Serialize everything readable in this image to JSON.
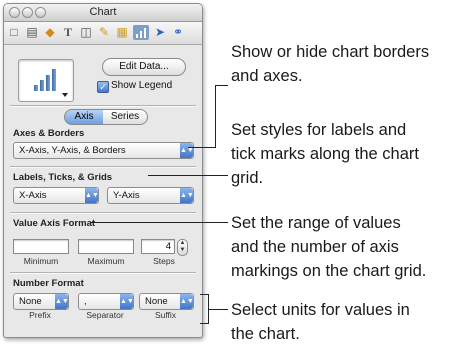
{
  "window": {
    "title": "Chart"
  },
  "toolbar": {
    "icons": [
      "document-icon",
      "layout-icon",
      "graphic-icon",
      "text-icon",
      "metrics-icon",
      "brush-icon",
      "table-icon",
      "chart-icon",
      "hyperlink-icon",
      "quicktime-icon"
    ],
    "selected": "chart-icon"
  },
  "chart_options": {
    "edit_data_label": "Edit Data...",
    "show_legend_label": "Show Legend",
    "show_legend_checked": true
  },
  "tabs": {
    "axis_label": "Axis",
    "series_label": "Series",
    "selected": "Axis"
  },
  "axes_borders": {
    "label": "Axes & Borders",
    "value": "X-Axis, Y-Axis, & Borders"
  },
  "labels_ticks_grids": {
    "label": "Labels, Ticks, & Grids",
    "x_value": "X-Axis",
    "y_value": "Y-Axis"
  },
  "value_axis_format": {
    "label": "Value Axis Format",
    "minimum_label": "Minimum",
    "maximum_label": "Maximum",
    "steps_label": "Steps",
    "minimum_value": "",
    "maximum_value": "",
    "steps_value": "4"
  },
  "number_format": {
    "label": "Number Format",
    "prefix_value": "None",
    "prefix_label": "Prefix",
    "separator_value": ",",
    "separator_label": "Separator",
    "suffix_value": "None",
    "suffix_label": "Suffix"
  },
  "callouts": {
    "c1_line1": "Show or hide chart borders",
    "c1_line2": "and axes.",
    "c2_line1": "Set styles for labels and",
    "c2_line2": "tick marks along the chart",
    "c2_line3": "grid.",
    "c3_line1": "Set the range of values",
    "c3_line2": "and the number of axis",
    "c3_line3": "markings on the chart grid.",
    "c4_line1": "Select units for values in",
    "c4_line2": "the chart."
  }
}
